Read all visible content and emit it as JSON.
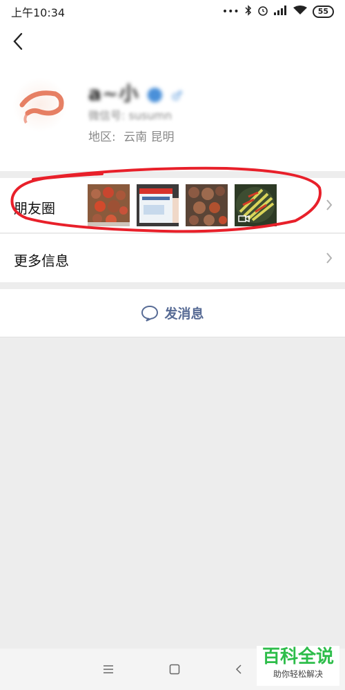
{
  "status_bar": {
    "time": "上午10:34",
    "battery": "55",
    "dots": "•••"
  },
  "profile": {
    "nickname": "a~小",
    "wechat_id_label": "微信号: susumn",
    "region_label": "地区:",
    "region_value": "云南  昆明"
  },
  "moments": {
    "label": "朋友圈",
    "thumbnails": [
      {
        "icon": "food-photo-icon"
      },
      {
        "icon": "product-box-photo-icon"
      },
      {
        "icon": "food-photo-icon"
      },
      {
        "icon": "video-thumbnail-icon"
      }
    ]
  },
  "more_info": {
    "label": "更多信息"
  },
  "actions": {
    "send_message": "发消息"
  },
  "watermark": {
    "title": "百科全说",
    "subtitle": "助你轻松解决"
  },
  "colors": {
    "link_blue": "#576b95",
    "annotation_red": "#e8202a",
    "watermark_green": "#2dbd4a"
  }
}
